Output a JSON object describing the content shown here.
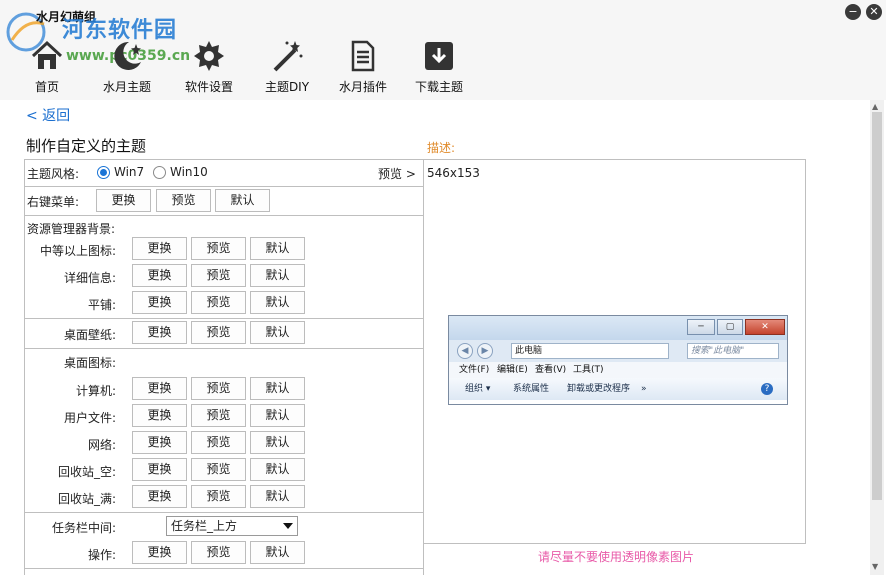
{
  "window": {
    "title": "水月幻萌组",
    "watermark_text": "河东软件园",
    "watermark_url": "www.pc0359.cn",
    "minimize_label": "−",
    "close_label": "✕"
  },
  "nav": [
    {
      "label": "首页",
      "icon": "home-icon"
    },
    {
      "label": "水月主题",
      "icon": "moon-star-icon"
    },
    {
      "label": "软件设置",
      "icon": "gear-icon"
    },
    {
      "label": "主题DIY",
      "icon": "magic-wand-icon"
    },
    {
      "label": "水月插件",
      "icon": "document-icon"
    },
    {
      "label": "下载主题",
      "icon": "download-box-icon"
    }
  ],
  "back_label": "< 返回",
  "page_title": "制作自定义的主题",
  "description_label": "描述:",
  "theme_style": {
    "label": "主题风格:",
    "options": [
      "Win7",
      "Win10"
    ],
    "selected": "Win7",
    "preview_link": "预览 >"
  },
  "buttons": {
    "replace": "更换",
    "preview": "预览",
    "default": "默认"
  },
  "context_menu_label": "右键菜单:",
  "explorer_bg_label": "资源管理器背景:",
  "explorer_rows": [
    "中等以上图标:",
    "详细信息:",
    "平铺:"
  ],
  "wallpaper_label": "桌面壁纸:",
  "desktop_icons_label": "桌面图标:",
  "desktop_icon_rows": [
    "计算机:",
    "用户文件:",
    "网络:",
    "回收站_空:",
    "回收站_满:"
  ],
  "taskbar": {
    "label": "任务栏中间:",
    "selected": "任务栏_上方"
  },
  "operation_label": "操作:",
  "preview": {
    "size_text": "546x153",
    "explorer": {
      "address": "此电脑",
      "search_placeholder": "搜索\"此电脑\"",
      "menu": [
        "文件(F)",
        "编辑(E)",
        "查看(V)",
        "工具(T)"
      ],
      "commands": [
        "组织 ▾",
        "系统属性",
        "卸载或更改程序",
        "»"
      ]
    }
  },
  "hint": "请尽量不要使用透明像素图片"
}
